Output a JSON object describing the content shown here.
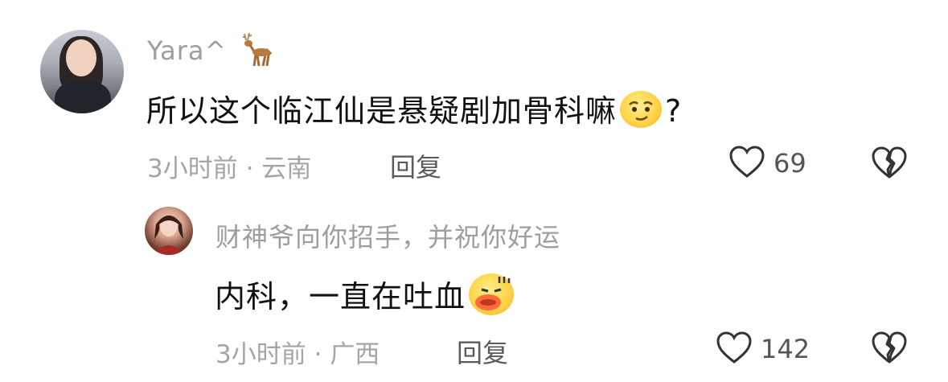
{
  "comment": {
    "username": "Yara^",
    "username_emoji": "deer-icon",
    "text": "所以这个临江仙是悬疑剧加骨科嘛",
    "text_suffix": "?",
    "time": "3小时前",
    "location": "云南",
    "separator": "·",
    "reply_label": "回复",
    "likes": "69"
  },
  "reply": {
    "username": "财神爷向你招手，并祝你好运",
    "text": "内科，一直在吐血",
    "time": "3小时前",
    "location": "广西",
    "separator": "·",
    "reply_label": "回复",
    "likes": "142"
  },
  "colors": {
    "username": "#9e9e9e",
    "text": "#111111",
    "meta": "#a5a5a5",
    "emoji_yellow": "#ffd34a"
  }
}
